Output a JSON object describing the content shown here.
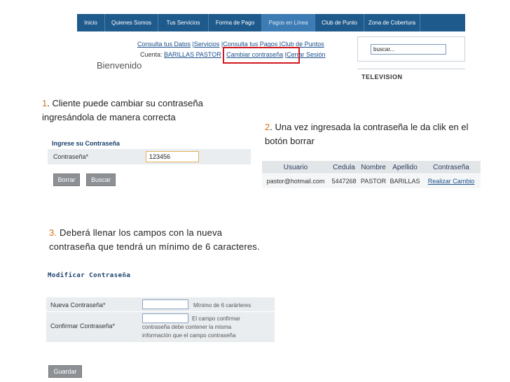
{
  "nav": {
    "items": [
      "Inicio",
      "Quienes Somos",
      "Tus Servicios",
      "Forma de Pago",
      "Pagos en Línea",
      "Club de Punto",
      "Zona de Cobertura"
    ]
  },
  "account": {
    "links_line": [
      "Consulta tus Datos",
      "Servicios",
      "Consulta tus Pagos",
      "Club de Puntos"
    ],
    "cuenta_label": "Cuenta:",
    "cuenta_user": "BARILLAS PASTOR",
    "change_password": "Cambiar contraseña",
    "logout": "Cerrar Sesión",
    "welcome": "Bienvenido"
  },
  "sidebar": {
    "search_value": "buscar...",
    "tv_label": "TELEVISION"
  },
  "steps": {
    "step1_num": "1",
    "step1_text": ". Cliente puede cambiar su contraseña ingresándola de manera correcta",
    "step2_num": "2",
    "step2_text": ". Una vez ingresada la contraseña le da clik en el botón borrar",
    "step3_num": "3.",
    "step3_text": " Deberá llenar los campos con la nueva contraseña que tendrá un mínimo de 6 caracteres."
  },
  "form1": {
    "title": "Ingrese su Contraseña",
    "label": "Contraseña*",
    "value": "123456",
    "btn_borrar": "Borrar",
    "btn_buscar": "Buscar"
  },
  "results": {
    "headers": [
      "Usuario",
      "Cedula",
      "Nombre",
      "Apellido",
      "Contraseña"
    ],
    "row": [
      "pastor@hotmail.com",
      "5447268",
      "PASTOR",
      "BARILLAS",
      "Realizar Cambio"
    ]
  },
  "form3": {
    "title": "Modificar Contraseña",
    "new_label": "Nueva Contraseña*",
    "new_note": "Mínimo de 6 carárteres",
    "confirm_label": "Confirmar Contraseña*",
    "confirm_note_a": "El campo confirmar",
    "confirm_note_b": "contraseña debe contener la misma",
    "confirm_note_c": "información que el campo contraseña",
    "btn_guardar": "Guardar"
  }
}
